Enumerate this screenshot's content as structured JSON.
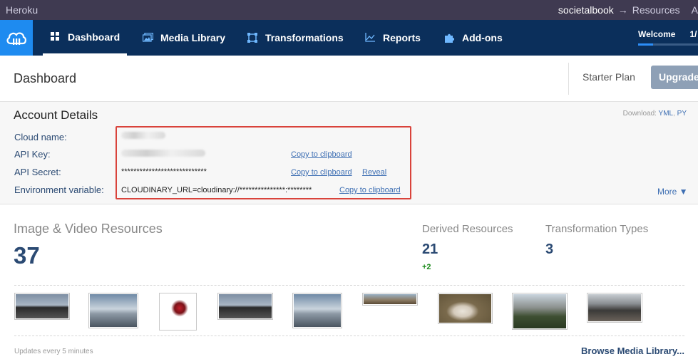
{
  "heroku": {
    "brand": "Heroku",
    "app": "societalbook",
    "arrow": "→",
    "section": "Resources",
    "tail": "A"
  },
  "nav": {
    "items": [
      {
        "label": "Dashboard",
        "icon": "grid-icon"
      },
      {
        "label": "Media Library",
        "icon": "images-icon"
      },
      {
        "label": "Transformations",
        "icon": "crop-icon"
      },
      {
        "label": "Reports",
        "icon": "chart-icon"
      },
      {
        "label": "Add-ons",
        "icon": "puzzle-icon"
      }
    ],
    "welcome": "Welcome",
    "welcome_count": "1/",
    "welcome_progress": 0.25
  },
  "header": {
    "title": "Dashboard",
    "plan": "Starter Plan",
    "upgrade": "Upgrade"
  },
  "account": {
    "title": "Account Details",
    "download_label": "Download:",
    "download_yml": "YML",
    "download_sep": ",",
    "download_py": "PY",
    "cloud_name_label": "Cloud name:",
    "api_key_label": "API Key:",
    "api_secret_label": "API Secret:",
    "api_secret_value": "****************************",
    "env_label": "Environment variable:",
    "env_value": "CLOUDINARY_URL=cloudinary://***************:********",
    "copy_label": "Copy to clipboard",
    "reveal_label": "Reveal",
    "more_label": "More ▼"
  },
  "resources": {
    "image_video_title": "Image & Video Resources",
    "image_video_count": "37",
    "derived_title": "Derived Resources",
    "derived_count": "21",
    "derived_delta": "+2",
    "transform_title": "Transformation Types",
    "transform_count": "3",
    "update_note": "Updates every 5 minutes",
    "browse_label": "Browse Media Library..."
  },
  "colors": {
    "heroku_bar": "#3f3a51",
    "nav_bg": "#0b2f5b",
    "logo_bg": "#1e8bf0",
    "link": "#3e6fb3",
    "highlight": "#d9433b",
    "delta": "#1a8a1a"
  }
}
